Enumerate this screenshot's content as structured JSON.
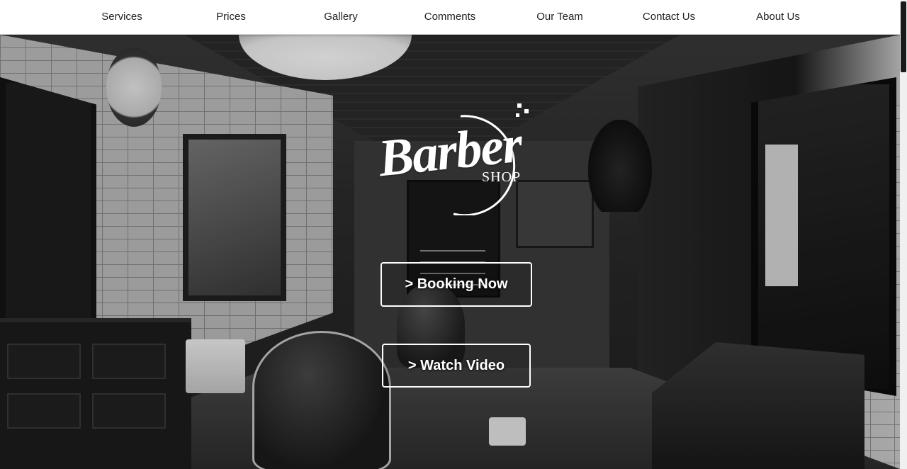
{
  "nav": {
    "items": [
      {
        "label": "Services"
      },
      {
        "label": "Prices"
      },
      {
        "label": "Gallery"
      },
      {
        "label": "Comments"
      },
      {
        "label": "Our Team"
      },
      {
        "label": "Contact Us"
      },
      {
        "label": "About Us"
      }
    ]
  },
  "logo": {
    "main": "Barber",
    "sub": "SHOP"
  },
  "hero": {
    "booking_label": "> Booking Now",
    "video_label": "> Watch Video"
  },
  "colors": {
    "nav_background": "#ffffff",
    "nav_text": "#222222",
    "button_border": "#ffffff",
    "button_text": "#ffffff"
  },
  "icons": [
    "clock-icon",
    "lamp-icon"
  ]
}
